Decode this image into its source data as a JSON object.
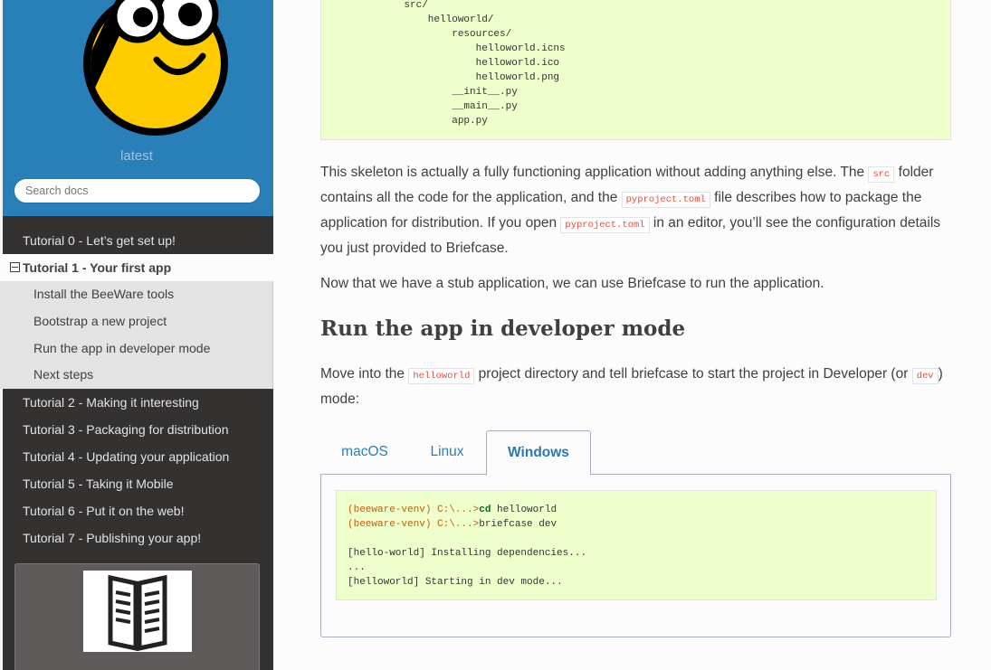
{
  "sidebar": {
    "version": "latest",
    "search_placeholder": "Search docs",
    "nav": [
      {
        "label": "Tutorial 0 - Let’s get set up!"
      },
      {
        "label": "Tutorial 1 - Your first app",
        "current": true
      },
      {
        "label": "Tutorial 2 - Making it interesting"
      },
      {
        "label": "Tutorial 3 - Packaging for distribution"
      },
      {
        "label": "Tutorial 4 - Updating your application"
      },
      {
        "label": "Tutorial 5 - Taking it Mobile"
      },
      {
        "label": "Tutorial 6 - Put it on the web!"
      },
      {
        "label": "Tutorial 7 - Publishing your app!"
      }
    ],
    "subnav": [
      {
        "label": "Install the BeeWare tools"
      },
      {
        "label": "Bootstrap a new project"
      },
      {
        "label": "Run the app in developer mode"
      },
      {
        "label": "Next steps"
      }
    ],
    "colors": {
      "header": "#2980b9",
      "nav_bg": "#343131"
    }
  },
  "tree_lines": [
    "    src/",
    "        helloworld/",
    "            resources/",
    "                helloworld.icns",
    "                helloworld.ico",
    "                helloworld.png",
    "            __init__.py",
    "            __main__.py",
    "            app.py"
  ],
  "para1": {
    "t1": "This skeleton is actually a fully functioning application without adding anything else. The ",
    "c1": "src",
    "t2": " folder contains all the code for the application, and the ",
    "c2": "pyproject.toml",
    "t3": " file describes how to package the application for distribution. If you open ",
    "c3": "pyproject.toml",
    "t4": " in an editor, you’ll see the configuration details you just provided to Briefcase."
  },
  "para2": "Now that we have a stub application, we can use Briefcase to run the application.",
  "heading": "Run the app in developer mode",
  "para3": {
    "t1": "Move into the ",
    "c1": "helloworld",
    "t2": " project directory and tell briefcase to start the project in Developer (or ",
    "c2": "dev",
    "t3": ") mode:"
  },
  "tabs": [
    {
      "label": "macOS"
    },
    {
      "label": "Linux"
    },
    {
      "label": "Windows",
      "active": true
    }
  ],
  "console": {
    "line1_prompt": "(beeware-venv) C:\\...>",
    "line1_cmd": "cd",
    "line1_rest": " helloworld",
    "line2_prompt": "(beeware-venv) C:\\...>",
    "line2_cmd": "briefcase dev",
    "out1": "[hello-world] Installing dependencies...",
    "out2": "...",
    "out3": "[helloworld] Starting in dev mode..."
  },
  "icons": [
    "bee-logo-icon",
    "book-icon"
  ]
}
